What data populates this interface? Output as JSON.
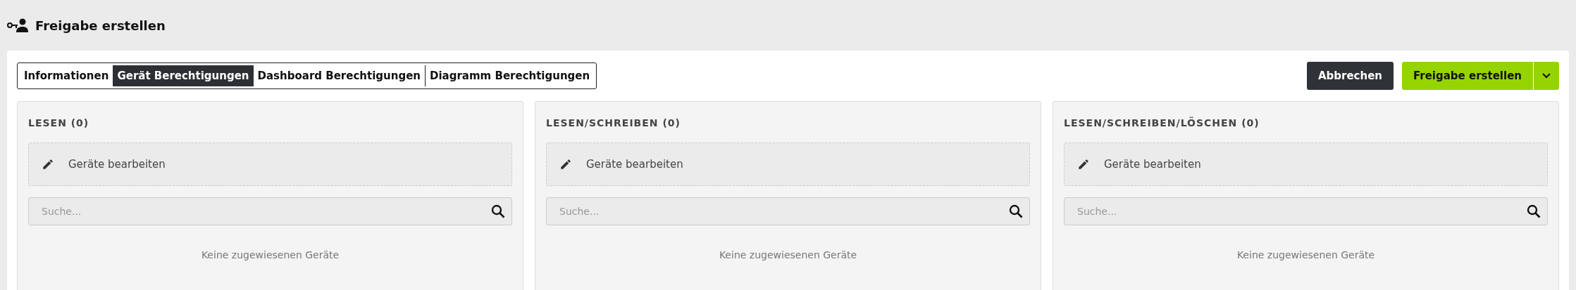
{
  "header": {
    "title": "Freigabe erstellen"
  },
  "tabs": [
    {
      "label": "Informationen",
      "selected": false
    },
    {
      "label": "Gerät Berechtigungen",
      "selected": true
    },
    {
      "label": "Dashboard Berechtigungen",
      "selected": false
    },
    {
      "label": "Diagramm Berechtigungen",
      "selected": false
    }
  ],
  "actions": {
    "cancel": "Abbrechen",
    "submit": "Freigabe erstellen"
  },
  "panels": [
    {
      "title": "LESEN (0)",
      "edit": "Geräte bearbeiten",
      "search": {
        "placeholder": "Suche..."
      },
      "empty": "Keine zugewiesenen Geräte"
    },
    {
      "title": "LESEN/SCHREIBEN (0)",
      "edit": "Geräte bearbeiten",
      "search": {
        "placeholder": "Suche..."
      },
      "empty": "Keine zugewiesenen Geräte"
    },
    {
      "title": "LESEN/SCHREIBEN/LÖSCHEN (0)",
      "edit": "Geräte bearbeiten",
      "search": {
        "placeholder": "Suche..."
      },
      "empty": "Keine zugewiesenen Geräte"
    }
  ]
}
